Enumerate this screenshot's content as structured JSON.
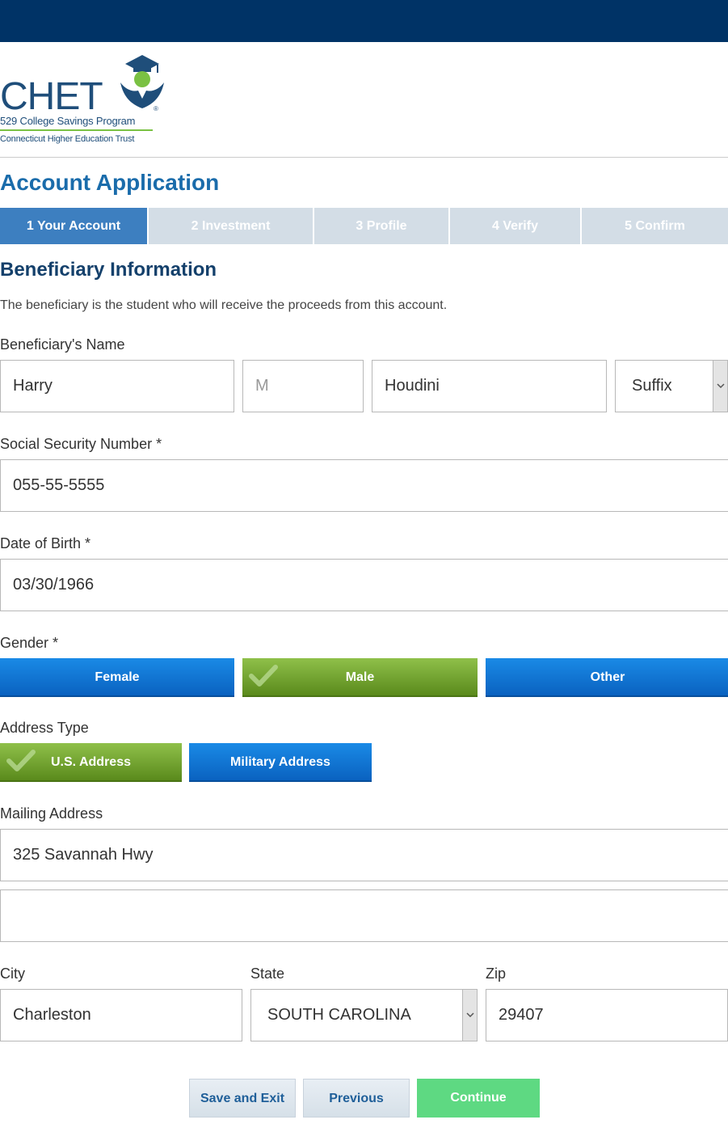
{
  "logo": {
    "name": "CHET",
    "registered": "®",
    "subtitle": "529 College Savings Program",
    "tagline": "Connecticut Higher Education Trust",
    "colors": {
      "brand": "#1f4e7a",
      "accent": "#7ac143"
    }
  },
  "page": {
    "title": "Account Application"
  },
  "steps": [
    {
      "label": "1 Your Account",
      "active": true
    },
    {
      "label": "2 Investment",
      "active": false
    },
    {
      "label": "3 Profile",
      "active": false
    },
    {
      "label": "4 Verify",
      "active": false
    },
    {
      "label": "5 Confirm",
      "active": false
    }
  ],
  "section": {
    "title": "Beneficiary Information",
    "intro": "The beneficiary is the student who will receive the proceeds from this account."
  },
  "name": {
    "label": "Beneficiary's Name",
    "first": "Harry",
    "middle_placeholder": "M",
    "last": "Houdini",
    "suffix": "Suffix"
  },
  "ssn": {
    "label": "Social Security Number *",
    "value": "055-55-5555"
  },
  "dob": {
    "label": "Date of Birth *",
    "value": "03/30/1966"
  },
  "gender": {
    "label": "Gender *",
    "options": [
      "Female",
      "Male",
      "Other"
    ],
    "selected": "Male"
  },
  "address_type": {
    "label": "Address Type",
    "options": [
      "U.S. Address",
      "Military Address"
    ],
    "selected": "U.S. Address"
  },
  "mailing": {
    "label": "Mailing Address",
    "line1": "325 Savannah Hwy",
    "line2": ""
  },
  "city": {
    "label": "City",
    "value": "Charleston"
  },
  "state": {
    "label": "State",
    "value": "SOUTH CAROLINA"
  },
  "zip": {
    "label": "Zip",
    "value": "29407"
  },
  "actions": {
    "save_exit": "Save and Exit",
    "previous": "Previous",
    "continue": "Continue"
  },
  "colors": {
    "header": "#003366",
    "step_active": "#3d7fc0",
    "step_inactive": "#d3dde6",
    "button_blue": "#0a62c0",
    "button_green": "#5a8a1c",
    "continue": "#5ed982"
  }
}
